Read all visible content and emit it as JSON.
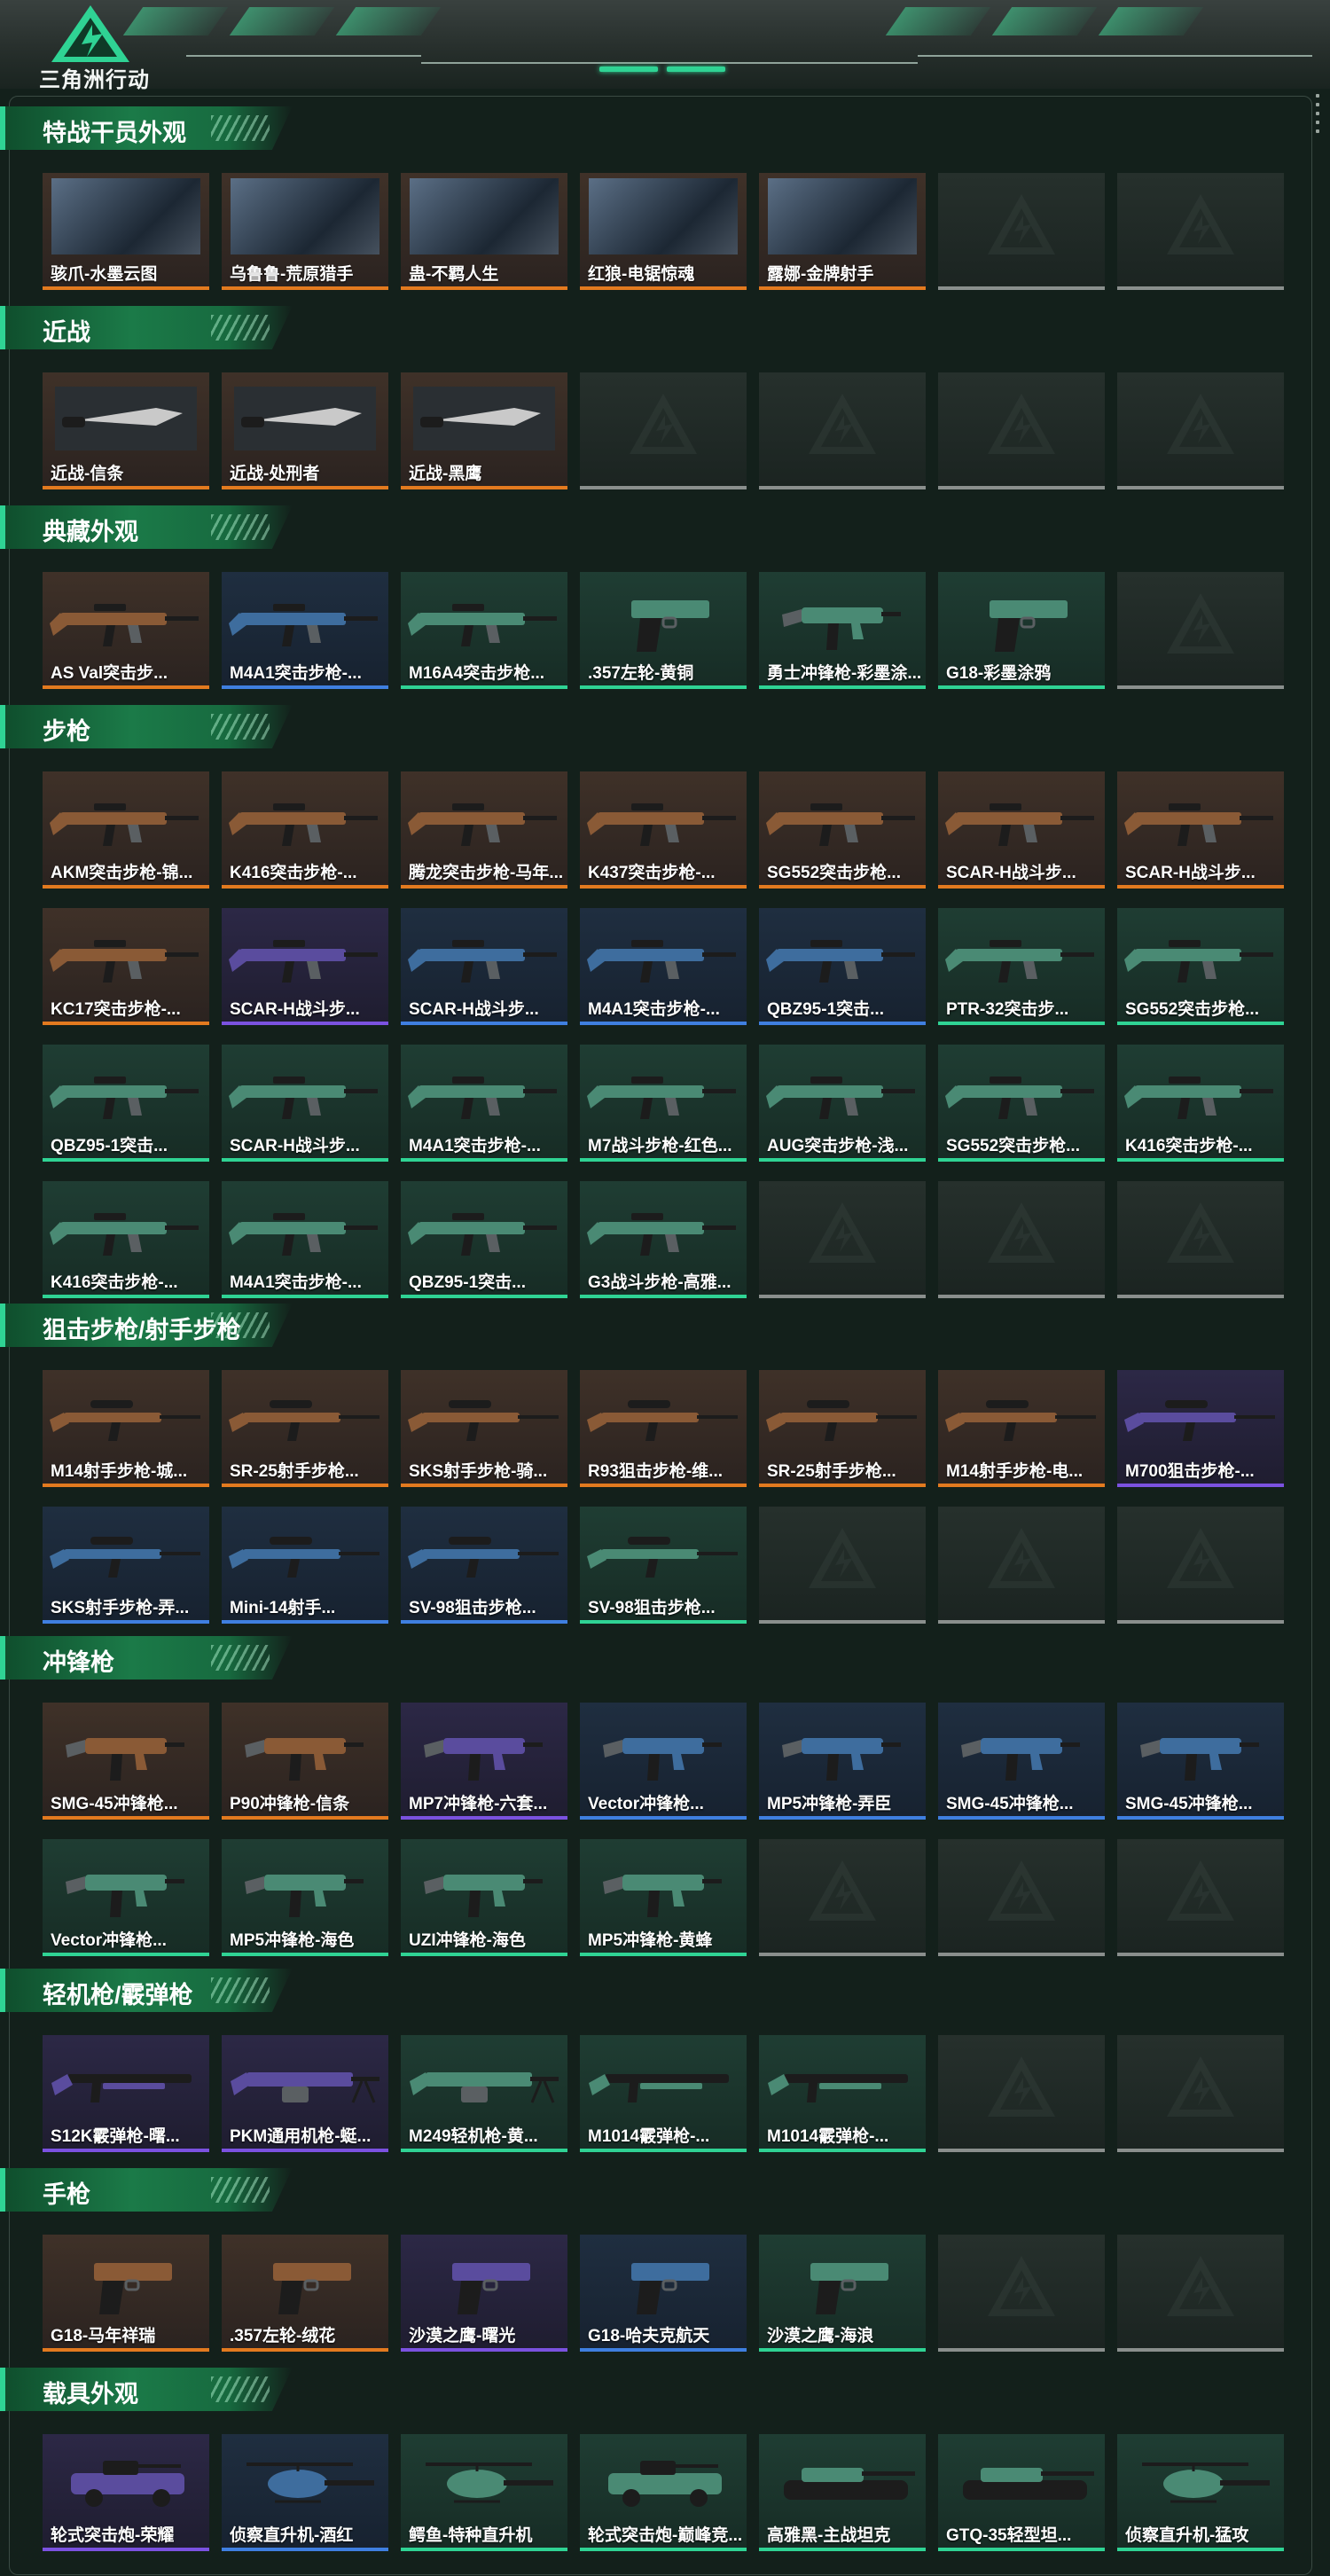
{
  "app": {
    "brand": "三角洲行动"
  },
  "colors": {
    "accent": "#2fd394",
    "gold": "#e37a1f",
    "purple": "#7b52e0",
    "blue": "#3f7fe0",
    "green": "#2fd394",
    "empty": "#8a8f8d"
  },
  "sections": [
    {
      "title": "特战干员外观",
      "items": [
        {
          "label": "骇爪-水墨云图",
          "quality": "gold",
          "kind": "portrait"
        },
        {
          "label": "乌鲁鲁-荒原猎手",
          "quality": "gold",
          "kind": "portrait"
        },
        {
          "label": "蛊-不羁人生",
          "quality": "gold",
          "kind": "portrait"
        },
        {
          "label": "红狼-电锯惊魂",
          "quality": "gold",
          "kind": "portrait"
        },
        {
          "label": "露娜-金牌射手",
          "quality": "gold",
          "kind": "portrait"
        },
        {
          "label": "",
          "quality": "empty",
          "kind": "empty"
        },
        {
          "label": "",
          "quality": "empty",
          "kind": "empty"
        }
      ]
    },
    {
      "title": "近战",
      "items": [
        {
          "label": "近战-信条",
          "quality": "gold",
          "kind": "knife"
        },
        {
          "label": "近战-处刑者",
          "quality": "gold",
          "kind": "knife"
        },
        {
          "label": "近战-黑鹰",
          "quality": "gold",
          "kind": "knife"
        },
        {
          "label": "",
          "quality": "empty",
          "kind": "empty"
        },
        {
          "label": "",
          "quality": "empty",
          "kind": "empty"
        },
        {
          "label": "",
          "quality": "empty",
          "kind": "empty"
        },
        {
          "label": "",
          "quality": "empty",
          "kind": "empty"
        }
      ]
    },
    {
      "title": "典藏外观",
      "items": [
        {
          "label": "AS Val突击步...",
          "quality": "gold",
          "kind": "rifle"
        },
        {
          "label": "M4A1突击步枪-...",
          "quality": "blue",
          "kind": "rifle"
        },
        {
          "label": "M16A4突击步枪...",
          "quality": "green",
          "kind": "rifle"
        },
        {
          "label": ".357左轮-黄铜",
          "quality": "green",
          "kind": "pistol"
        },
        {
          "label": "勇士冲锋枪-彩墨涂...",
          "quality": "green",
          "kind": "smg"
        },
        {
          "label": "G18-彩墨涂鸦",
          "quality": "green",
          "kind": "pistol"
        },
        {
          "label": "",
          "quality": "empty",
          "kind": "empty"
        }
      ]
    },
    {
      "title": "步枪",
      "items": [
        {
          "label": "AKM突击步枪-锦...",
          "quality": "gold",
          "kind": "rifle"
        },
        {
          "label": "K416突击步枪-...",
          "quality": "gold",
          "kind": "rifle"
        },
        {
          "label": "腾龙突击步枪-马年...",
          "quality": "gold",
          "kind": "rifle"
        },
        {
          "label": "K437突击步枪-...",
          "quality": "gold",
          "kind": "rifle"
        },
        {
          "label": "SG552突击步枪...",
          "quality": "gold",
          "kind": "rifle"
        },
        {
          "label": "SCAR-H战斗步...",
          "quality": "gold",
          "kind": "rifle"
        },
        {
          "label": "SCAR-H战斗步...",
          "quality": "gold",
          "kind": "rifle"
        },
        {
          "label": "KC17突击步枪-...",
          "quality": "gold",
          "kind": "rifle"
        },
        {
          "label": "SCAR-H战斗步...",
          "quality": "purple",
          "kind": "rifle"
        },
        {
          "label": "SCAR-H战斗步...",
          "quality": "blue",
          "kind": "rifle"
        },
        {
          "label": "M4A1突击步枪-...",
          "quality": "blue",
          "kind": "rifle"
        },
        {
          "label": "QBZ95-1突击...",
          "quality": "blue",
          "kind": "rifle"
        },
        {
          "label": "PTR-32突击步...",
          "quality": "green",
          "kind": "rifle"
        },
        {
          "label": "SG552突击步枪...",
          "quality": "green",
          "kind": "rifle"
        },
        {
          "label": "QBZ95-1突击...",
          "quality": "green",
          "kind": "rifle"
        },
        {
          "label": "SCAR-H战斗步...",
          "quality": "green",
          "kind": "rifle"
        },
        {
          "label": "M4A1突击步枪-...",
          "quality": "green",
          "kind": "rifle"
        },
        {
          "label": "M7战斗步枪-红色...",
          "quality": "green",
          "kind": "rifle"
        },
        {
          "label": "AUG突击步枪-浅...",
          "quality": "green",
          "kind": "rifle"
        },
        {
          "label": "SG552突击步枪...",
          "quality": "green",
          "kind": "rifle"
        },
        {
          "label": "K416突击步枪-...",
          "quality": "green",
          "kind": "rifle"
        },
        {
          "label": "K416突击步枪-...",
          "quality": "green",
          "kind": "rifle"
        },
        {
          "label": "M4A1突击步枪-...",
          "quality": "green",
          "kind": "rifle"
        },
        {
          "label": "QBZ95-1突击...",
          "quality": "green",
          "kind": "rifle"
        },
        {
          "label": "G3战斗步枪-高雅...",
          "quality": "green",
          "kind": "rifle"
        },
        {
          "label": "",
          "quality": "empty",
          "kind": "empty"
        },
        {
          "label": "",
          "quality": "empty",
          "kind": "empty"
        },
        {
          "label": "",
          "quality": "empty",
          "kind": "empty"
        }
      ]
    },
    {
      "title": "狙击步枪/射手步枪",
      "items": [
        {
          "label": "M14射手步枪-城...",
          "quality": "gold",
          "kind": "sniper"
        },
        {
          "label": "SR-25射手步枪...",
          "quality": "gold",
          "kind": "sniper"
        },
        {
          "label": "SKS射手步枪-骑...",
          "quality": "gold",
          "kind": "sniper"
        },
        {
          "label": "R93狙击步枪-维...",
          "quality": "gold",
          "kind": "sniper"
        },
        {
          "label": "SR-25射手步枪...",
          "quality": "gold",
          "kind": "sniper"
        },
        {
          "label": "M14射手步枪-电...",
          "quality": "gold",
          "kind": "sniper"
        },
        {
          "label": "M700狙击步枪-...",
          "quality": "purple",
          "kind": "sniper"
        },
        {
          "label": "SKS射手步枪-弄...",
          "quality": "blue",
          "kind": "sniper"
        },
        {
          "label": "Mini-14射手...",
          "quality": "blue",
          "kind": "sniper"
        },
        {
          "label": "SV-98狙击步枪...",
          "quality": "blue",
          "kind": "sniper"
        },
        {
          "label": "SV-98狙击步枪...",
          "quality": "green",
          "kind": "sniper"
        },
        {
          "label": "",
          "quality": "empty",
          "kind": "empty"
        },
        {
          "label": "",
          "quality": "empty",
          "kind": "empty"
        },
        {
          "label": "",
          "quality": "empty",
          "kind": "empty"
        }
      ]
    },
    {
      "title": "冲锋枪",
      "items": [
        {
          "label": "SMG-45冲锋枪...",
          "quality": "gold",
          "kind": "smg"
        },
        {
          "label": "P90冲锋枪-信条",
          "quality": "gold",
          "kind": "smg"
        },
        {
          "label": "MP7冲锋枪-六套...",
          "quality": "purple",
          "kind": "smg"
        },
        {
          "label": "Vector冲锋枪...",
          "quality": "blue",
          "kind": "smg"
        },
        {
          "label": "MP5冲锋枪-弄臣",
          "quality": "blue",
          "kind": "smg"
        },
        {
          "label": "SMG-45冲锋枪...",
          "quality": "blue",
          "kind": "smg"
        },
        {
          "label": "SMG-45冲锋枪...",
          "quality": "blue",
          "kind": "smg"
        },
        {
          "label": "Vector冲锋枪...",
          "quality": "green",
          "kind": "smg"
        },
        {
          "label": "MP5冲锋枪-海色",
          "quality": "green",
          "kind": "smg"
        },
        {
          "label": "UZI冲锋枪-海色",
          "quality": "green",
          "kind": "smg"
        },
        {
          "label": "MP5冲锋枪-黄蜂",
          "quality": "green",
          "kind": "smg"
        },
        {
          "label": "",
          "quality": "empty",
          "kind": "empty"
        },
        {
          "label": "",
          "quality": "empty",
          "kind": "empty"
        },
        {
          "label": "",
          "quality": "empty",
          "kind": "empty"
        }
      ]
    },
    {
      "title": "轻机枪/霰弹枪",
      "items": [
        {
          "label": "S12K霰弹枪-曙...",
          "quality": "purple",
          "kind": "shotgun"
        },
        {
          "label": "PKM通用机枪-蜓...",
          "quality": "purple",
          "kind": "lmg"
        },
        {
          "label": "M249轻机枪-黄...",
          "quality": "green",
          "kind": "lmg"
        },
        {
          "label": "M1014霰弹枪-...",
          "quality": "green",
          "kind": "shotgun"
        },
        {
          "label": "M1014霰弹枪-...",
          "quality": "green",
          "kind": "shotgun"
        },
        {
          "label": "",
          "quality": "empty",
          "kind": "empty"
        },
        {
          "label": "",
          "quality": "empty",
          "kind": "empty"
        }
      ]
    },
    {
      "title": "手枪",
      "items": [
        {
          "label": "G18-马年祥瑞",
          "quality": "gold",
          "kind": "pistol"
        },
        {
          "label": ".357左轮-绒花",
          "quality": "gold",
          "kind": "pistol"
        },
        {
          "label": "沙漠之鹰-曙光",
          "quality": "purple",
          "kind": "pistol"
        },
        {
          "label": "G18-哈夫克航天",
          "quality": "blue",
          "kind": "pistol"
        },
        {
          "label": "沙漠之鹰-海浪",
          "quality": "green",
          "kind": "pistol"
        },
        {
          "label": "",
          "quality": "empty",
          "kind": "empty"
        },
        {
          "label": "",
          "quality": "empty",
          "kind": "empty"
        }
      ]
    },
    {
      "title": "载具外观",
      "items": [
        {
          "label": "轮式突击炮-荣耀",
          "quality": "purple",
          "kind": "vehicle"
        },
        {
          "label": "侦察直升机-酒红",
          "quality": "blue",
          "kind": "heli"
        },
        {
          "label": "鳄鱼-特种直升机",
          "quality": "green",
          "kind": "heli"
        },
        {
          "label": "轮式突击炮-巅峰竞...",
          "quality": "green",
          "kind": "vehicle"
        },
        {
          "label": "高雅黑-主战坦克",
          "quality": "green",
          "kind": "tank"
        },
        {
          "label": "GTQ-35轻型坦...",
          "quality": "green",
          "kind": "tank"
        },
        {
          "label": "侦察直升机-猛攻",
          "quality": "green",
          "kind": "heli"
        }
      ]
    }
  ]
}
